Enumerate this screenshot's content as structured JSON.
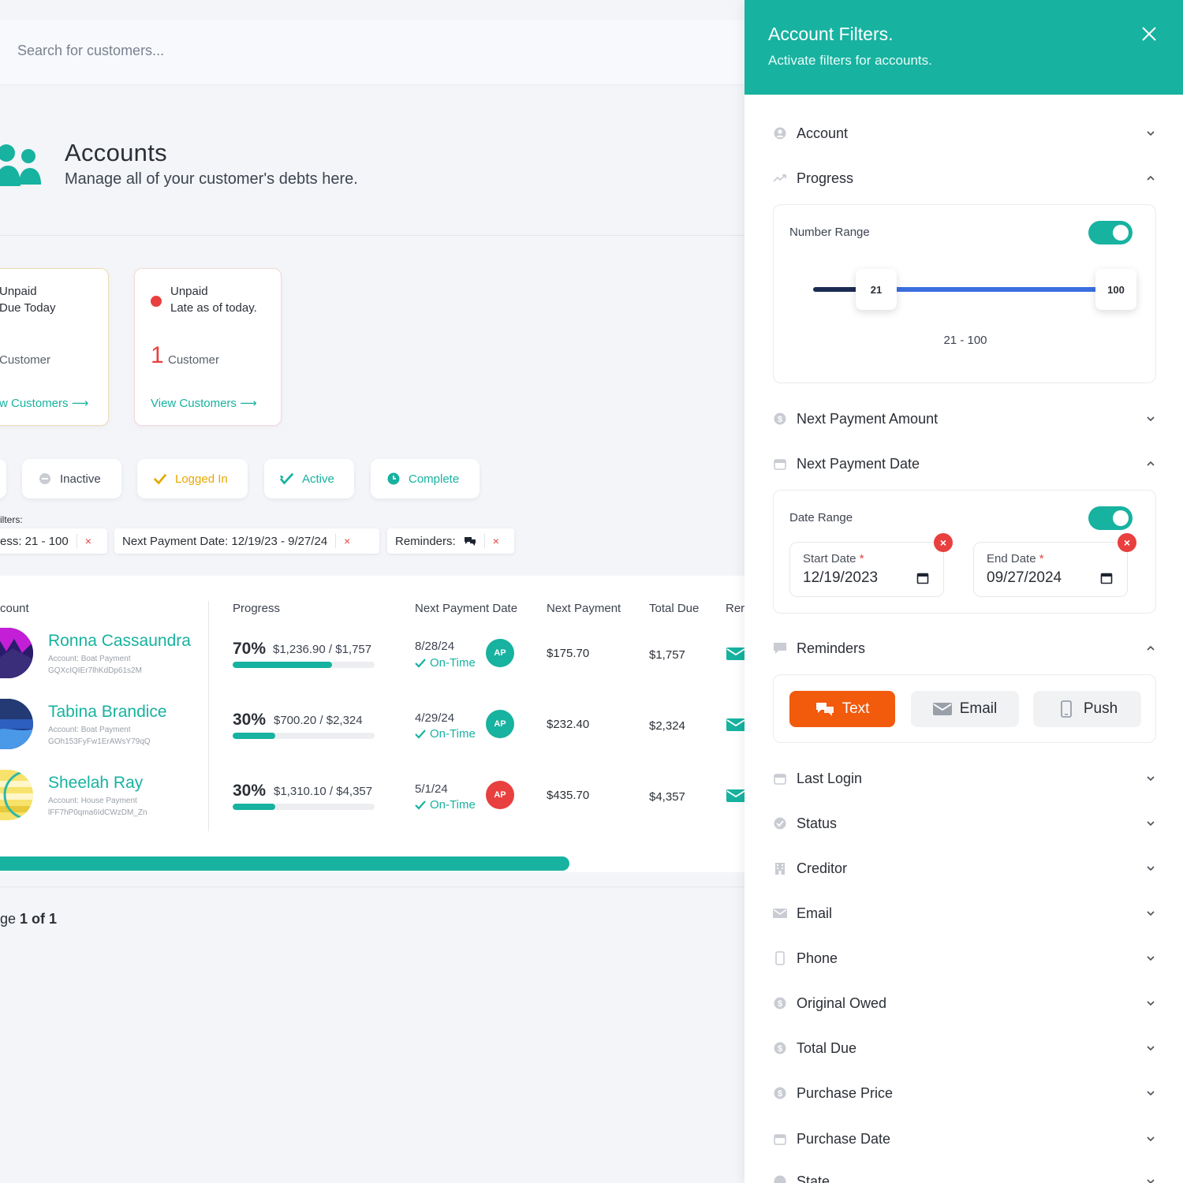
{
  "search": {
    "placeholder": "Search for customers..."
  },
  "header": {
    "title": "Accounts",
    "subtitle": "Manage all of your customer's debts here."
  },
  "cards": [
    {
      "line1": "Unpaid",
      "line2": "Due Today",
      "unit": "Customer",
      "link": "w Customers"
    },
    {
      "line1": "Unpaid",
      "line2": "Late as of today.",
      "count": "1",
      "unit": "Customer",
      "link": "View Customers"
    }
  ],
  "status_buttons": [
    {
      "label": "Inactive",
      "color": "#3d4350"
    },
    {
      "label": "Logged In",
      "color": "#e7a800"
    },
    {
      "label": "Active",
      "color": "#17b2a0"
    },
    {
      "label": "Complete",
      "color": "#17b2a0"
    }
  ],
  "filters": {
    "label": "ilters:",
    "chips": [
      {
        "label": "ess: 21 - 100",
        "remove": "×"
      },
      {
        "label": "Next Payment Date: 12/19/23 - 9/27/24",
        "remove": "×"
      },
      {
        "label": "Reminders:",
        "remove": "×"
      }
    ]
  },
  "table": {
    "columns": [
      "count",
      "Progress",
      "Next Payment Date",
      "Next Payment",
      "Total Due",
      "Rer"
    ],
    "rows": [
      {
        "name": "Ronna Cassaundra",
        "account": "Account: Boat Payment",
        "id": "GQXcIQIEr7lhKdDp61s2M",
        "pct": "70%",
        "progress": 0.7,
        "amount": "$1,236.90 / $1,757",
        "date": "8/28/24",
        "status": "On-Time",
        "badge": "AP",
        "badge_color": "#17b2a0",
        "next": "$175.70",
        "total": "$1,757"
      },
      {
        "name": "Tabina Brandice",
        "account": "Account: Boat Payment",
        "id": "GOh153FyFw1ErAWsY79qQ",
        "pct": "30%",
        "progress": 0.3,
        "amount": "$700.20 / $2,324",
        "date": "4/29/24",
        "status": "On-Time",
        "badge": "AP",
        "badge_color": "#17b2a0",
        "next": "$232.40",
        "total": "$2,324"
      },
      {
        "name": "Sheelah Ray",
        "account": "Account: House Payment",
        "id": "lFF7hP0qma6IdCWzDM_Zn",
        "pct": "30%",
        "progress": 0.3,
        "amount": "$1,310.10 / $4,357",
        "date": "5/1/24",
        "status": "On-Time",
        "badge": "AP",
        "badge_color": "#e8403f",
        "next": "$435.70",
        "total": "$4,357"
      }
    ]
  },
  "pager": {
    "prefix": "ge",
    "current": "1 of 1"
  },
  "panel": {
    "title": "Account Filters.",
    "subtitle": "Activate filters for accounts.",
    "sections_top": [
      {
        "label": "Account",
        "icon": "user-circle-icon",
        "open": false
      },
      {
        "label": "Progress",
        "icon": "trend-icon",
        "open": true
      }
    ],
    "progress": {
      "label": "Number Range",
      "min": 21,
      "max": 100,
      "low_label": "21",
      "high_label": "100",
      "range_text": "21 - 100"
    },
    "sections_mid": [
      {
        "label": "Next Payment Amount",
        "icon": "dollar-icon",
        "open": false
      },
      {
        "label": "Next Payment Date",
        "icon": "calendar-icon",
        "open": true
      }
    ],
    "date_range": {
      "label": "Date Range",
      "start_label": "Start Date",
      "start_value": "12/19/2023",
      "end_label": "End Date",
      "end_value": "09/27/2024",
      "required": "*"
    },
    "reminders": {
      "label": "Reminders",
      "buttons": [
        {
          "label": "Text"
        },
        {
          "label": "Email"
        },
        {
          "label": "Push"
        }
      ]
    },
    "sections_bottom": [
      "Last Login",
      "Status",
      "Creditor",
      "Email",
      "Phone",
      "Original Owed",
      "Total Due",
      "Purchase Price",
      "Purchase Date",
      "State"
    ]
  },
  "colors": {
    "accent": "#17b2a0",
    "danger": "#e8403f",
    "orange": "#f25a0c",
    "blue": "#3b6fe0"
  }
}
